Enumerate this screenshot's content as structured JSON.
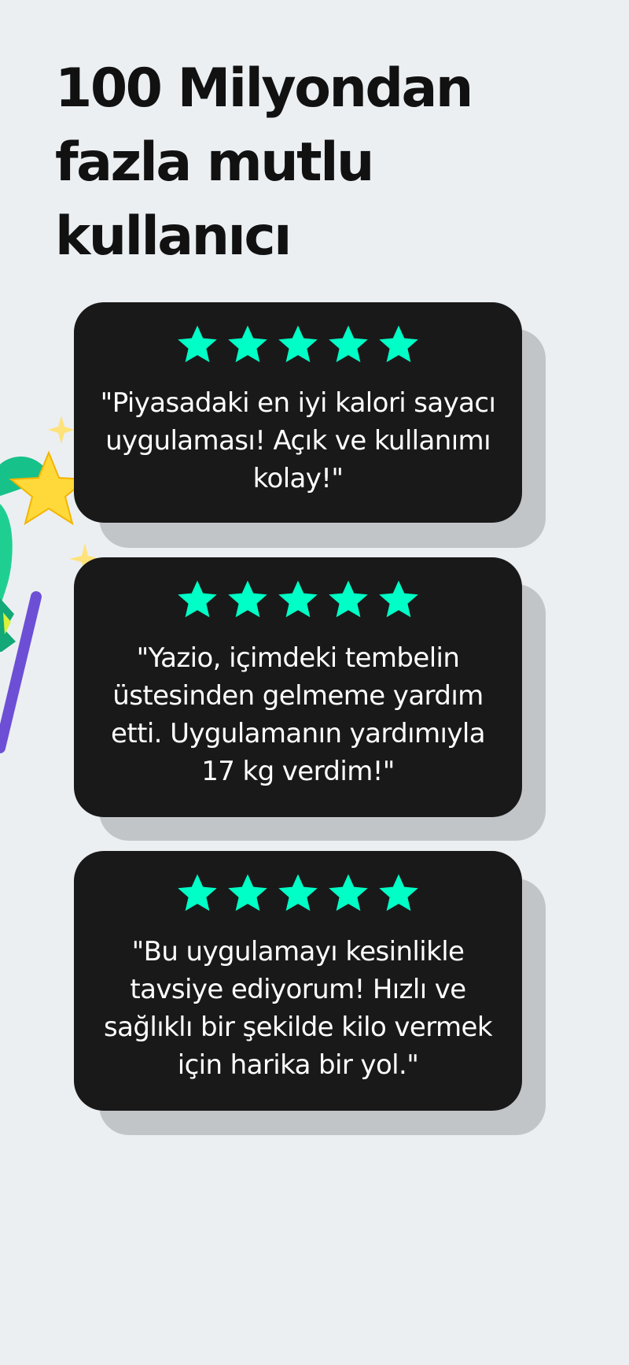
{
  "headline": "100 Milyondan fazla mutlu kullanıcı",
  "reviews": [
    {
      "rating": 5,
      "quote": "\"Piyasadaki en iyi kalori sayacı uygulaması! Açık ve kullanımı kolay!\""
    },
    {
      "rating": 5,
      "quote": "\"Yazio, içimdeki tembelin üstesinden gelmeme yardım etti. Uygulamanın yardımıyla 17 kg verdim!\""
    },
    {
      "rating": 5,
      "quote": "\"Bu uygulamayı kesinlikle tavsiye ediyorum! Hızlı ve sağlıklı bir şekilde kilo vermek için harika bir yol.\""
    }
  ],
  "colors": {
    "background": "#ebeff2",
    "card": "#1a1919",
    "card_shadow": "#c2c5c8",
    "star": "#00ffc6",
    "headline": "#111111",
    "quote_text": "#ffffff"
  },
  "icons": [
    "star-icon",
    "mascot-illustration",
    "sparkle-icon"
  ]
}
